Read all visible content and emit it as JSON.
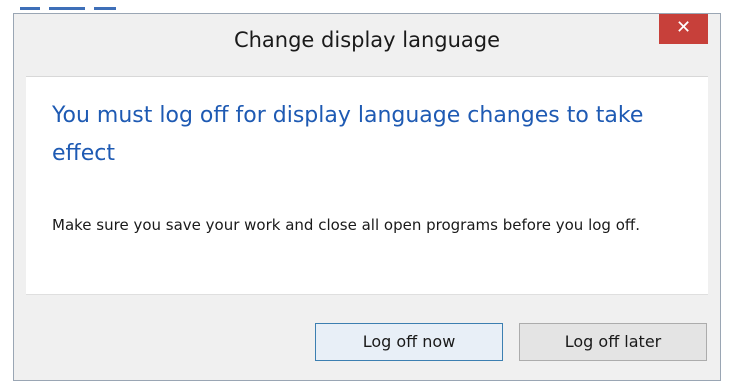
{
  "dialog": {
    "title": "Change display language",
    "close_label": "✕"
  },
  "message": {
    "heading": "You must log off for display language changes to take effect",
    "body": "Make sure you save your work and close all open programs before you log off."
  },
  "buttons": {
    "primary": "Log off now",
    "secondary": "Log off later"
  },
  "colors": {
    "heading": "#1e5ab3",
    "close_button": "#c7403a",
    "primary_border": "#3c7fb1"
  }
}
